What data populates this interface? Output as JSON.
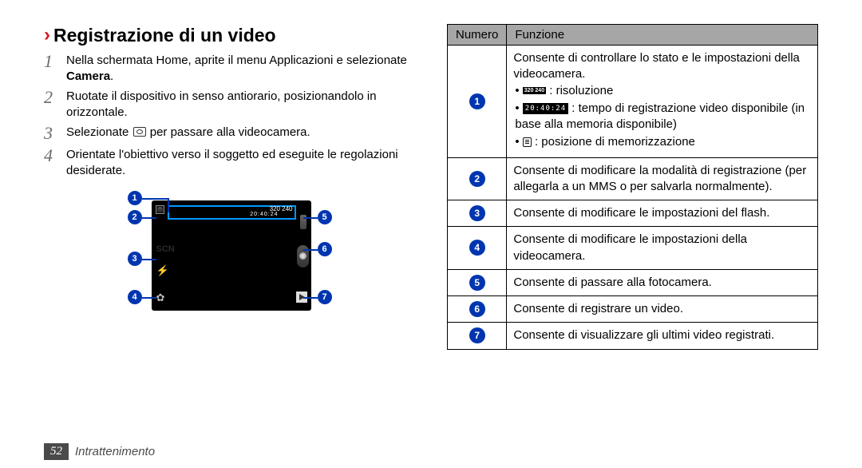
{
  "section": {
    "heading": "Registrazione di un video",
    "steps": [
      {
        "num": "1",
        "pre": "Nella schermata Home, aprite il menu Applicazioni e selezionate ",
        "bold": "Camera",
        "post": "."
      },
      {
        "num": "2",
        "text": "Ruotate il dispositivo in senso antiorario, posizionandolo in orizzontale."
      },
      {
        "num": "3",
        "pre": "Selezionate ",
        "icon": "camera-mode-icon",
        "post": " per passare alla videocamera."
      },
      {
        "num": "4",
        "text": "Orientate l'obiettivo verso il soggetto ed eseguite le regolazioni desiderate."
      }
    ]
  },
  "diagram": {
    "scn_label": "SCN",
    "resolution_label": "320\n240",
    "time_label": "20:40:24"
  },
  "table": {
    "head_num": "Numero",
    "head_func": "Funzione",
    "row1": {
      "desc_line": "Consente di controllare lo stato e le impostazioni della videocamera.",
      "bul1_text": " : risoluzione",
      "bul2_text": " : tempo di registrazione video disponibile (in base alla memoria disponibile)",
      "bul3_text": " : posizione di memorizzazione",
      "time_badge": "20:40:24",
      "res_badge": "320\n240"
    },
    "row2": "Consente di modificare la modalità di registrazione (per allegarla a un MMS o per salvarla normalmente).",
    "row3": "Consente di modificare le impostazioni del flash.",
    "row4": "Consente di modificare le impostazioni della videocamera.",
    "row5": "Consente di passare alla fotocamera.",
    "row6": "Consente di registrare un video.",
    "row7": "Consente di visualizzare gli ultimi video registrati."
  },
  "footer": {
    "page": "52",
    "section": "Intrattenimento"
  }
}
